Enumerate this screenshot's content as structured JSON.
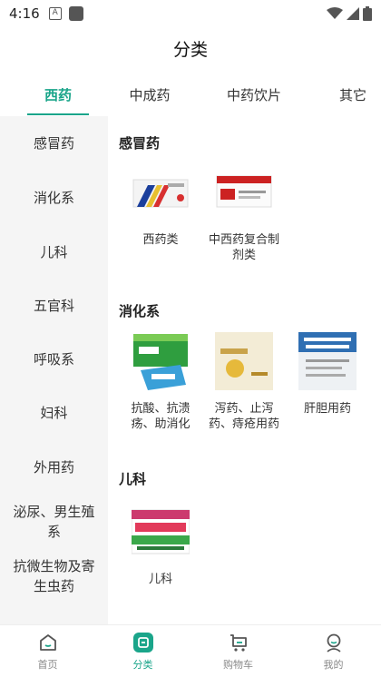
{
  "status_bar": {
    "time": "4:16",
    "notif_icon_letter": "A"
  },
  "title": "分类",
  "accent_color": "#1aa58a",
  "tabs": [
    {
      "label": "西药",
      "active": true
    },
    {
      "label": "中成药",
      "active": false
    },
    {
      "label": "中药饮片",
      "active": false
    },
    {
      "label": "其它",
      "active": false
    }
  ],
  "sidebar": {
    "items": [
      {
        "label": "感冒药"
      },
      {
        "label": "消化系"
      },
      {
        "label": "儿科"
      },
      {
        "label": "五官科"
      },
      {
        "label": "呼吸系"
      },
      {
        "label": "妇科"
      },
      {
        "label": "外用药"
      },
      {
        "label": "泌尿、男生殖系"
      },
      {
        "label": "抗微生物及寄生虫药"
      }
    ]
  },
  "sections": [
    {
      "title": "感冒药",
      "products": [
        {
          "label": "西药类",
          "icon": "cold-medicine-box"
        },
        {
          "label": "中西药复合制剂类",
          "icon": "compound-tablet-box"
        }
      ]
    },
    {
      "title": "消化系",
      "products": [
        {
          "label": "抗酸、抗溃疡、助消化",
          "icon": "antacid-box"
        },
        {
          "label": "泻药、止泻药、痔疮用药",
          "icon": "laxative-box"
        },
        {
          "label": "肝胆用药",
          "icon": "liver-medicine-box"
        }
      ]
    },
    {
      "title": "儿科",
      "products": [
        {
          "label": "儿科",
          "icon": "pediatric-granule-box"
        }
      ]
    }
  ],
  "bottom_nav": [
    {
      "label": "首页",
      "icon": "home-icon",
      "active": false
    },
    {
      "label": "分类",
      "icon": "category-icon",
      "active": true
    },
    {
      "label": "购物车",
      "icon": "cart-icon",
      "active": false
    },
    {
      "label": "我的",
      "icon": "profile-icon",
      "active": false
    }
  ]
}
